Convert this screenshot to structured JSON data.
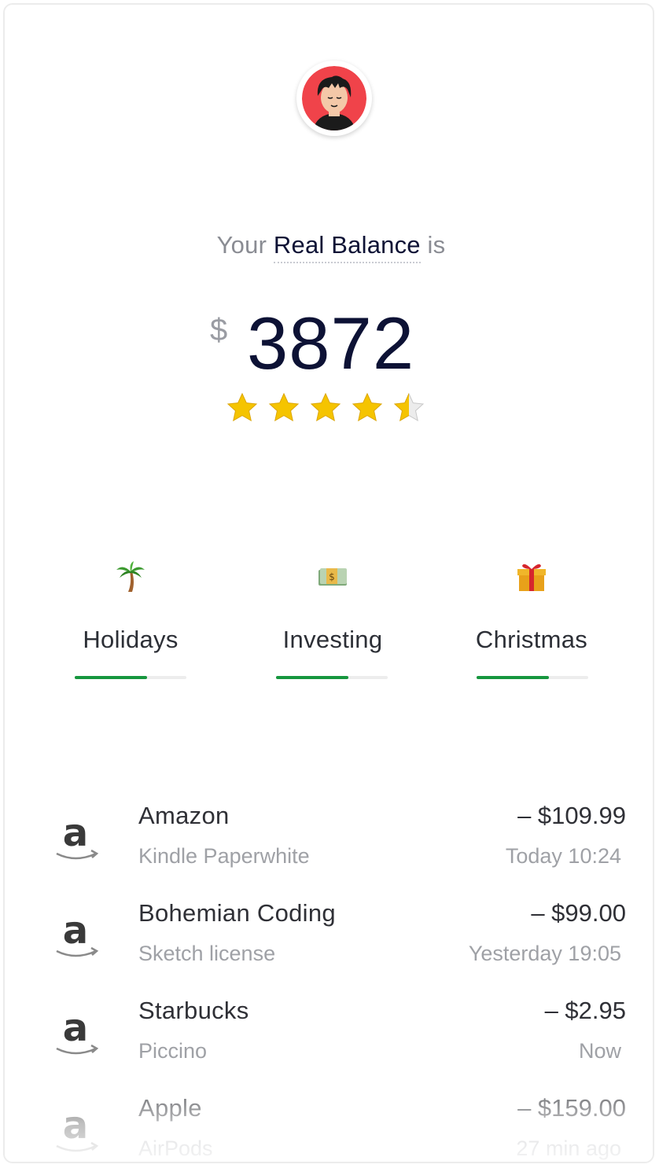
{
  "balance": {
    "prefix": "Your",
    "highlight": "Real Balance",
    "suffix": "is",
    "currency": "$",
    "amount": "3872",
    "rating": 4.5,
    "rating_max": 5
  },
  "goals": [
    {
      "label": "Holidays",
      "icon": "palm-tree-icon",
      "progress": 0.65
    },
    {
      "label": "Investing",
      "icon": "money-icon",
      "progress": 0.65
    },
    {
      "label": "Christmas",
      "icon": "gift-icon",
      "progress": 0.65
    }
  ],
  "transactions": [
    {
      "merchant": "Amazon",
      "item": "Kindle Paperwhite",
      "amount": "– $109.99",
      "time": "Today 10:24",
      "icon": "amazon-icon"
    },
    {
      "merchant": "Bohemian Coding",
      "item": "Sketch license",
      "amount": "– $99.00",
      "time": "Yesterday 19:05",
      "icon": "amazon-icon"
    },
    {
      "merchant": "Starbucks",
      "item": "Piccino",
      "amount": "– $2.95",
      "time": "Now",
      "icon": "amazon-icon"
    },
    {
      "merchant": "Apple",
      "item": "AirPods",
      "amount": "– $159.00",
      "time": "27 min ago",
      "icon": "amazon-icon"
    }
  ],
  "colors": {
    "accent_green": "#16963e",
    "navy": "#0d1235",
    "star": "#f5c400",
    "avatar_bg": "#f0434a"
  }
}
